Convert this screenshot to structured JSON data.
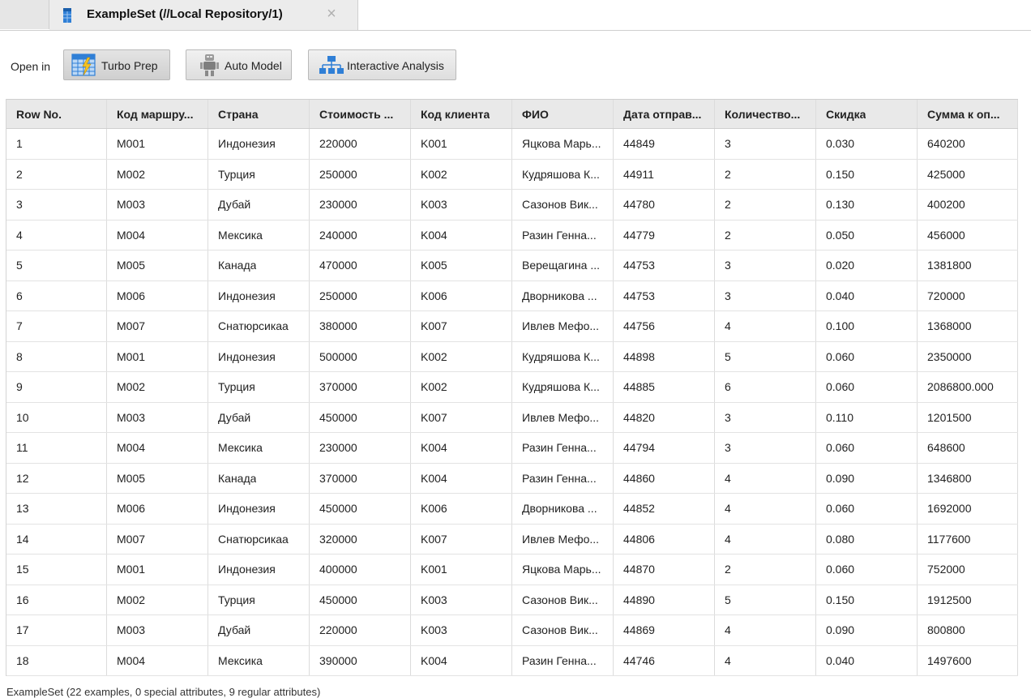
{
  "tab": {
    "title": "ExampleSet (//Local Repository/1)",
    "close_icon": "×"
  },
  "toolbar": {
    "open_in_label": "Open in",
    "turbo_prep_label": "Turbo Prep",
    "auto_model_label": "Auto Model",
    "interactive_analysis_label": "Interactive Analysis"
  },
  "table": {
    "headers": [
      "Row No.",
      "Код маршру...",
      "Страна",
      "Стоимость ...",
      "Код клиента",
      "ФИО",
      "Дата отправ...",
      "Количество...",
      "Скидка",
      "Сумма к оп..."
    ],
    "rows": [
      [
        "1",
        "M001",
        "Индонезия",
        "220000",
        "K001",
        "Яцкова Марь...",
        "44849",
        "3",
        "0.030",
        "640200"
      ],
      [
        "2",
        "M002",
        "Турция",
        "250000",
        "K002",
        "Кудряшова К...",
        "44911",
        "2",
        "0.150",
        "425000"
      ],
      [
        "3",
        "M003",
        "Дубай",
        "230000",
        "K003",
        "Сазонов Вик...",
        "44780",
        "2",
        "0.130",
        "400200"
      ],
      [
        "4",
        "M004",
        "Мексика",
        "240000",
        "K004",
        "Разин Генна...",
        "44779",
        "2",
        "0.050",
        "456000"
      ],
      [
        "5",
        "M005",
        "Канада",
        "470000",
        "K005",
        "Верещагина ...",
        "44753",
        "3",
        "0.020",
        "1381800"
      ],
      [
        "6",
        "M006",
        "Индонезия",
        "250000",
        "K006",
        "Дворникова ...",
        "44753",
        "3",
        "0.040",
        "720000"
      ],
      [
        "7",
        "M007",
        "Снатюрсикаа",
        "380000",
        "K007",
        "Ивлев Мефо...",
        "44756",
        "4",
        "0.100",
        "1368000"
      ],
      [
        "8",
        "M001",
        "Индонезия",
        "500000",
        "K002",
        "Кудряшова К...",
        "44898",
        "5",
        "0.060",
        "2350000"
      ],
      [
        "9",
        "M002",
        "Турция",
        "370000",
        "K002",
        "Кудряшова К...",
        "44885",
        "6",
        "0.060",
        "2086800.000"
      ],
      [
        "10",
        "M003",
        "Дубай",
        "450000",
        "K007",
        "Ивлев Мефо...",
        "44820",
        "3",
        "0.110",
        "1201500"
      ],
      [
        "11",
        "M004",
        "Мексика",
        "230000",
        "K004",
        "Разин Генна...",
        "44794",
        "3",
        "0.060",
        "648600"
      ],
      [
        "12",
        "M005",
        "Канада",
        "370000",
        "K004",
        "Разин Генна...",
        "44860",
        "4",
        "0.090",
        "1346800"
      ],
      [
        "13",
        "M006",
        "Индонезия",
        "450000",
        "K006",
        "Дворникова ...",
        "44852",
        "4",
        "0.060",
        "1692000"
      ],
      [
        "14",
        "M007",
        "Снатюрсикаа",
        "320000",
        "K007",
        "Ивлев Мефо...",
        "44806",
        "4",
        "0.080",
        "1177600"
      ],
      [
        "15",
        "M001",
        "Индонезия",
        "400000",
        "K001",
        "Яцкова Марь...",
        "44870",
        "2",
        "0.060",
        "752000"
      ],
      [
        "16",
        "M002",
        "Турция",
        "450000",
        "K003",
        "Сазонов Вик...",
        "44890",
        "5",
        "0.150",
        "1912500"
      ],
      [
        "17",
        "M003",
        "Дубай",
        "220000",
        "K003",
        "Сазонов Вик...",
        "44869",
        "4",
        "0.090",
        "800800"
      ],
      [
        "18",
        "M004",
        "Мексика",
        "390000",
        "K004",
        "Разин Генна...",
        "44746",
        "4",
        "0.040",
        "1497600"
      ]
    ]
  },
  "status_bar": {
    "text": "ExampleSet (22 examples, 0 special attributes, 9 regular attributes)"
  },
  "colors": {
    "header_bg": "#e9e9e9",
    "tab_bg": "#ececec",
    "icon_blue": "#2f7fd6",
    "grid_line": "#dcdcdc"
  },
  "icons": {
    "tab": "example-set-icon",
    "turbo_prep": "turbo-prep-icon",
    "auto_model": "robot-icon",
    "interactive_analysis": "hierarchy-icon"
  }
}
